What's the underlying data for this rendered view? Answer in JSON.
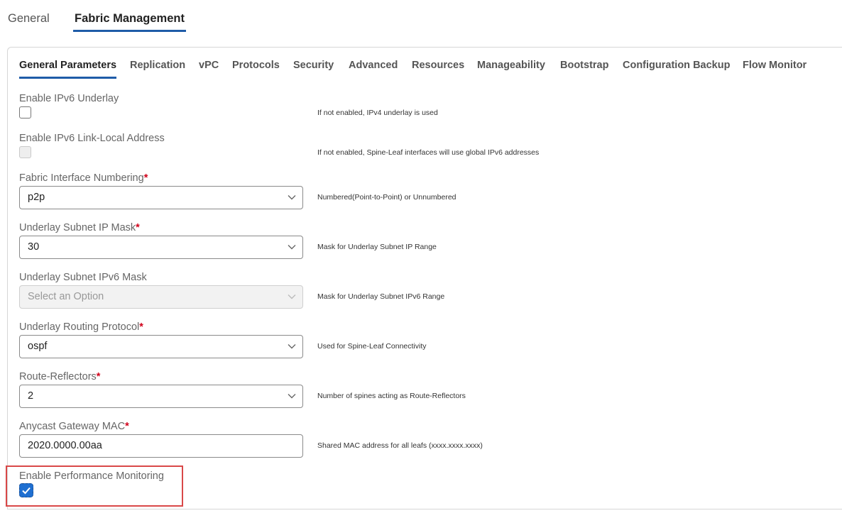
{
  "top_tabs": [
    {
      "label": "General",
      "active": false
    },
    {
      "label": "Fabric Management",
      "active": true
    }
  ],
  "sub_tabs": [
    {
      "label": "General Parameters",
      "active": true
    },
    {
      "label": "Replication"
    },
    {
      "label": "vPC"
    },
    {
      "label": "Protocols"
    },
    {
      "label": "Security"
    },
    {
      "label": "Advanced"
    },
    {
      "label": "Resources"
    },
    {
      "label": "Manageability"
    },
    {
      "label": "Bootstrap"
    },
    {
      "label": "Configuration Backup"
    },
    {
      "label": "Flow Monitor"
    }
  ],
  "fields": {
    "ipv6_underlay": {
      "label": "Enable IPv6 Underlay",
      "checked": false,
      "help": "If not enabled, IPv4 underlay is used"
    },
    "ipv6_link_local": {
      "label": "Enable IPv6 Link-Local Address",
      "checked": false,
      "disabled": true,
      "help": "If not enabled, Spine-Leaf interfaces will use global IPv6 addresses"
    },
    "interface_numbering": {
      "label": "Fabric Interface Numbering",
      "required": "*",
      "value": "p2p",
      "help": "Numbered(Point-to-Point) or Unnumbered"
    },
    "subnet_mask": {
      "label": "Underlay Subnet IP Mask",
      "required": "*",
      "value": "30",
      "help": "Mask for Underlay Subnet IP Range"
    },
    "subnet_ipv6_mask": {
      "label": "Underlay Subnet IPv6 Mask",
      "placeholder": "Select an Option",
      "disabled": true,
      "help": "Mask for Underlay Subnet IPv6 Range"
    },
    "routing_protocol": {
      "label": "Underlay Routing Protocol",
      "required": "*",
      "value": "ospf",
      "help": "Used for Spine-Leaf Connectivity"
    },
    "route_reflectors": {
      "label": "Route-Reflectors",
      "required": "*",
      "value": "2",
      "help": "Number of spines acting as Route-Reflectors"
    },
    "anycast_mac": {
      "label": "Anycast Gateway MAC",
      "required": "*",
      "value": "2020.0000.00aa",
      "help": "Shared MAC address for all leafs (xxxx.xxxx.xxxx)"
    },
    "perf_monitoring": {
      "label": "Enable Performance Monitoring",
      "checked": true
    }
  },
  "colors": {
    "accent": "#1f5ca8",
    "checkbox_checked": "#1f6fd1",
    "required": "#d0021b",
    "highlight": "#d94848"
  },
  "icons": {
    "dropdown": "chevron-down-icon",
    "check": "check-icon"
  }
}
